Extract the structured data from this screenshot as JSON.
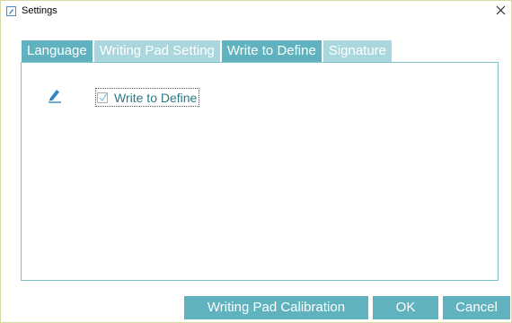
{
  "window": {
    "title": "Settings",
    "close_glyph": "×"
  },
  "tabs": [
    {
      "label": "Language",
      "state": "normal"
    },
    {
      "label": "Writing Pad Setting",
      "state": "dim"
    },
    {
      "label": "Write to Define",
      "state": "selected"
    },
    {
      "label": "Signature",
      "state": "dim"
    }
  ],
  "panel": {
    "icon": "pen-icon",
    "checkbox_label": "Write to Define",
    "checkbox_checked": true
  },
  "footer": {
    "calibration_label": "Writing Pad Calibration",
    "ok_label": "OK",
    "cancel_label": "Cancel"
  },
  "colors": {
    "accent": "#5fb2be",
    "accent_light": "#a9d7dd",
    "panel_border": "#7fc1cb",
    "label_text": "#2a7a86"
  }
}
